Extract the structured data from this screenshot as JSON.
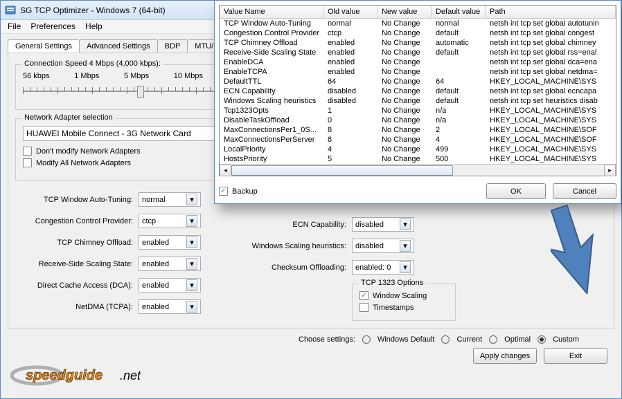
{
  "window": {
    "title": "SG TCP Optimizer - Windows 7 (64-bit)"
  },
  "menu": {
    "file": "File",
    "prefs": "Preferences",
    "help": "Help"
  },
  "tabs": {
    "general": "General Settings",
    "advanced": "Advanced Settings",
    "bdp": "BDP",
    "mtu": "MTU/"
  },
  "speed": {
    "legend": "Connection Speed  4 Mbps (4,000 kbps):",
    "l0": "56 kbps",
    "l1": "1 Mbps",
    "l2": "5 Mbps",
    "l3": "10 Mbps"
  },
  "adapter": {
    "legend": "Network Adapter selection",
    "value": "HUAWEI Mobile Connect - 3G Network Card",
    "dontModify": "Don't modify Network Adapters",
    "modifyAll": "Modify All Network Adapters"
  },
  "left": {
    "autoTuning": {
      "label": "TCP Window Auto-Tuning:",
      "value": "normal"
    },
    "congestion": {
      "label": "Congestion Control Provider:",
      "value": "ctcp"
    },
    "chimney": {
      "label": "TCP Chimney Offload:",
      "value": "enabled"
    },
    "rss": {
      "label": "Receive-Side Scaling State:",
      "value": "enabled"
    },
    "dca": {
      "label": "Direct Cache Access (DCA):",
      "value": "enabled"
    },
    "netdma": {
      "label": "NetDMA (TCPA):",
      "value": "enabled"
    }
  },
  "right": {
    "ecn": {
      "label": "ECN Capability:",
      "value": "disabled"
    },
    "wsh": {
      "label": "Windows Scaling heuristics:",
      "value": "disabled"
    },
    "chksum": {
      "label": "Checksum Offloading:",
      "value": "enabled: 0"
    },
    "tcp1323": {
      "legend": "TCP 1323 Options",
      "ws": "Window Scaling",
      "ts": "Timestamps"
    }
  },
  "bottom": {
    "choose": "Choose settings:",
    "r0": "Windows Default",
    "r1": "Current",
    "r2": "Optimal",
    "r3": "Custom",
    "apply": "Apply changes",
    "exit": "Exit"
  },
  "dialog": {
    "headers": {
      "name": "Value Name",
      "old": "Old value",
      "new": "New value",
      "def": "Default value",
      "path": "Path"
    },
    "rows": [
      {
        "n": "TCP Window Auto-Tuning",
        "o": "normal",
        "w": "No Change",
        "d": "normal",
        "p": "netsh int tcp set global autotunin"
      },
      {
        "n": "Congestion Control Provider",
        "o": "ctcp",
        "w": "No Change",
        "d": "default",
        "p": "netsh int tcp set global congest"
      },
      {
        "n": "TCP Chimney Offload",
        "o": "enabled",
        "w": "No Change",
        "d": "automatic",
        "p": "netsh int tcp set global chimney"
      },
      {
        "n": "Receive-Side Scaling State",
        "o": "enabled",
        "w": "No Change",
        "d": "default",
        "p": "netsh int tcp set global rss=enal"
      },
      {
        "n": "EnableDCA",
        "o": "enabled",
        "w": "No Change",
        "d": "",
        "p": "netsh int tcp set global dca=ena"
      },
      {
        "n": "EnableTCPA",
        "o": "enabled",
        "w": "No Change",
        "d": "",
        "p": "netsh int tcp set global netdma="
      },
      {
        "n": "DefaultTTL",
        "o": "64",
        "w": "No Change",
        "d": "64",
        "p": "HKEY_LOCAL_MACHINE\\SYS"
      },
      {
        "n": "ECN Capability",
        "o": "disabled",
        "w": "No Change",
        "d": "default",
        "p": "netsh int tcp set global ecncapa"
      },
      {
        "n": "Windows Scaling heuristics",
        "o": "disabled",
        "w": "No Change",
        "d": "default",
        "p": "netsh int tcp set heuristics disab"
      },
      {
        "n": "Tcp1323Opts",
        "o": "1",
        "w": "No Change",
        "d": "n/a",
        "p": "HKEY_LOCAL_MACHINE\\SYS"
      },
      {
        "n": "DisableTaskOffload",
        "o": "0",
        "w": "No Change",
        "d": "n/a",
        "p": "HKEY_LOCAL_MACHINE\\SYS"
      },
      {
        "n": "MaxConnectionsPer1_0S...",
        "o": "8",
        "w": "No Change",
        "d": "2",
        "p": "HKEY_LOCAL_MACHINE\\SOF"
      },
      {
        "n": "MaxConnectionsPerServer",
        "o": "8",
        "w": "No Change",
        "d": "4",
        "p": "HKEY_LOCAL_MACHINE\\SOF"
      },
      {
        "n": "LocalPriority",
        "o": "4",
        "w": "No Change",
        "d": "499",
        "p": "HKEY_LOCAL_MACHINE\\SYS"
      },
      {
        "n": "HostsPriority",
        "o": "5",
        "w": "No Change",
        "d": "500",
        "p": "HKEY_LOCAL_MACHINE\\SYS"
      }
    ],
    "backup": "Backup",
    "ok": "OK",
    "cancel": "Cancel"
  }
}
